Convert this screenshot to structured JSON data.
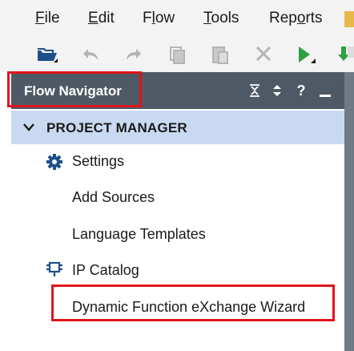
{
  "menubar": {
    "items": [
      {
        "underline": "F",
        "rest": "ile"
      },
      {
        "underline": "E",
        "rest": "dit"
      },
      {
        "pre": "F",
        "underline": "l",
        "rest": "ow"
      },
      {
        "underline": "T",
        "rest": "ools"
      },
      {
        "pre": "Rep",
        "underline": "o",
        "rest": "rts"
      }
    ]
  },
  "toolbar": {
    "icons": [
      "open-project-icon",
      "undo-icon",
      "redo-icon",
      "copy-icon",
      "paste-icon",
      "delete-icon",
      "run-icon",
      "download-icon"
    ]
  },
  "flow_navigator": {
    "title": "Flow Navigator",
    "header_icons": [
      "collapse-all-icon",
      "expand-all-icon",
      "help-icon",
      "minimize-icon"
    ],
    "section": {
      "label": "PROJECT MANAGER",
      "items": [
        {
          "label": "Settings",
          "icon": "gear-icon"
        },
        {
          "label": "Add Sources"
        },
        {
          "label": "Language Templates"
        },
        {
          "label": "IP Catalog",
          "icon": "ip-catalog-icon"
        },
        {
          "label": "Dynamic Function eXchange Wizard"
        }
      ]
    }
  },
  "colors": {
    "header_bg": "#4f5965",
    "section_bg": "#c9d9f1",
    "highlight": "#e0141b",
    "icon_blue": "#1d4f8c",
    "run_green": "#2ea043"
  }
}
